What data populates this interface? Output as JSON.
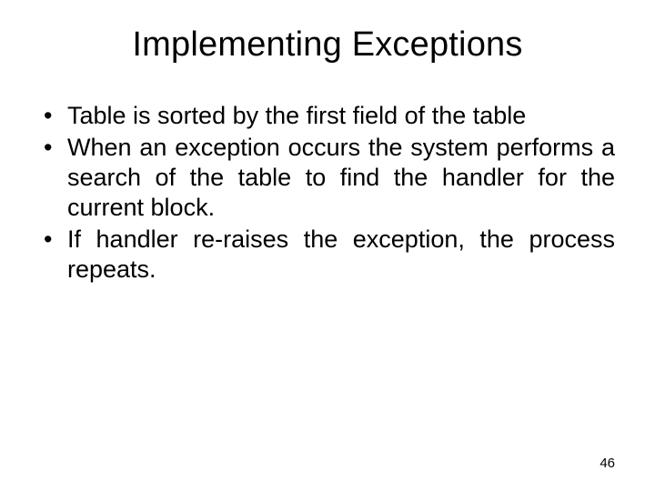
{
  "title": "Implementing Exceptions",
  "bullets": [
    "Table is sorted by the first field of the table",
    "When an exception occurs the system performs a search of the table to find the handler for the current block.",
    "If handler re-raises the exception, the process repeats."
  ],
  "page_number": "46"
}
